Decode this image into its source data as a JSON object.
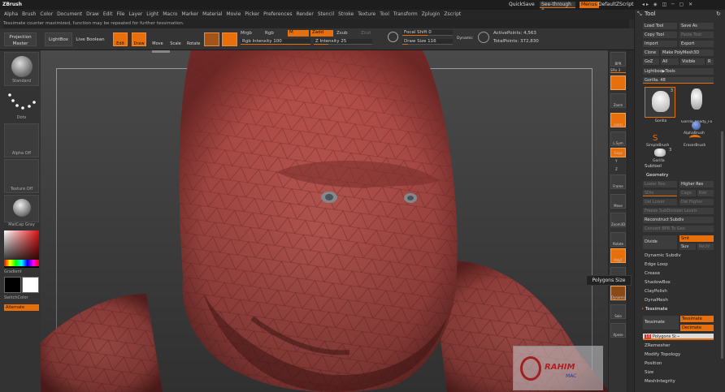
{
  "app": {
    "name": "ZBrush"
  },
  "titlebar": {
    "quicksave": "QuickSave",
    "seethrough": "See-through  0",
    "menus": "Menus",
    "defaultzscript": "DefaultZScript"
  },
  "menubar": [
    "Alpha",
    "Brush",
    "Color",
    "Document",
    "Draw",
    "Edit",
    "File",
    "Layer",
    "Light",
    "Macro",
    "Marker",
    "Material",
    "Movie",
    "Picker",
    "Preferences",
    "Render",
    "Stencil",
    "Stroke",
    "Texture",
    "Tool",
    "Transform",
    "Zplugin",
    "Zscript"
  ],
  "notice": "Tessimate counter maximized, function may be repeated for further tessimation.",
  "toolbar": {
    "projection_master": "Projection Master",
    "lightbox": "LightBox",
    "live_boolean": "Live Boolean",
    "edit": "Edit",
    "draw": "Draw",
    "move": "Move",
    "scale": "Scale",
    "rotate": "Rotate",
    "mrgb": "Mrgb",
    "rgb": "Rgb",
    "m": "M",
    "zadd": "Zadd",
    "zsub": "Zsub",
    "zcut": "Zcut",
    "rgb_intensity_label": "Rgb Intensity",
    "rgb_intensity_value": "100",
    "rgb_intensity_level": 1.0,
    "z_intensity_label": "Z Intensity",
    "z_intensity_value": "25",
    "z_intensity_level": 0.25,
    "focal_shift_label": "Focal Shift",
    "focal_shift_value": "0",
    "focal_shift_level": 0.5,
    "draw_size_label": "Draw Size",
    "draw_size_value": "116",
    "draw_size_level": 0.12,
    "dynamic": "Dynamic",
    "active_points_label": "ActivePoints:",
    "active_points_value": "4,563",
    "total_points_label": "TotalPoints:",
    "total_points_value": "372,830"
  },
  "leftshelf": {
    "brush": "Standard",
    "stroke": "Dots",
    "alpha": "Alpha Off",
    "texture": "Texture Off",
    "material": "MatCap Gray",
    "gradient": "Gradient",
    "switchcolor": "SwitchColor",
    "alternate": "Alternate"
  },
  "rightshelf": {
    "bpr": "BPR",
    "spix": "SPix 3",
    "zoom": "Zoom",
    "actual": "Actual",
    "aahalf": "AAHalf",
    "local": "Local",
    "lsym": "L.Sym",
    "gxyz": "Gxyz",
    "y": "Y",
    "z": "Z",
    "frame": "Frame",
    "move": "Move",
    "zoom3d": "Zoom3D",
    "rotate": "Rotate",
    "polyf": "PolyF",
    "transp": "Transp",
    "dynamic": "Dynamic",
    "solo": "Solo",
    "xpose": "Xpose"
  },
  "tooltip": "Polygons Size",
  "panel": {
    "title": "Tool",
    "load_tool": "Load Tool",
    "save_as": "Save As",
    "copy_tool": "Copy Tool",
    "paste_tool": "Paste Tool",
    "import": "Import",
    "export": "Export",
    "clone": "Clone",
    "make_polymesh": "Make PolyMesh3D",
    "goz": "GoZ",
    "all": "All",
    "visible": "Visible",
    "r": "R",
    "lightbox_tools": "Lightbox▶Tools",
    "gorilla_label": "Gorilla. 48",
    "tools": [
      {
        "name": "Gorilla",
        "count": "3"
      },
      {
        "name": "Gorilla_Ready_Fo",
        "count": ""
      },
      {
        "name": "",
        "count": ""
      },
      {
        "name": "AlphaBrush",
        "count": ""
      },
      {
        "name": "SimpleBrush",
        "count": ""
      },
      {
        "name": "EraserBrush",
        "count": ""
      },
      {
        "name": "Gorilla",
        "count": "3"
      }
    ],
    "subtool": "Subtool",
    "geometry": "Geometry",
    "lower_res": "Lower Res",
    "higher_res": "Higher Res",
    "sdiv": "SDiv",
    "cage": "Cage",
    "rstr": "Rstr",
    "del_lower": "Del Lower",
    "del_higher": "Del Higher",
    "freeze_subdiv": "Freeze SubDivision Levels",
    "reconstruct_subdiv": "Reconstruct Subdiv",
    "convert_bpr": "Convert BPR To Geo",
    "divide": "Divide",
    "smt": "Smt",
    "suv": "Suv",
    "reuv": "ReUV",
    "dynamic_subdiv": "Dynamic Subdiv",
    "edge_loop": "Edge Loop",
    "crease": "Crease",
    "shadowbox": "ShadowBox",
    "claypolish": "ClayPolish",
    "dynamesh": "DynaMesh",
    "tessimate_section": "Tessimate",
    "tessimate_btn": "Tessimate",
    "tessimate_label": "Tessimate",
    "decimate_btn": "Decimate",
    "polygons_size_value": "10",
    "polygons_size_label": "Polygons Size",
    "zremesher": "ZRemesher",
    "modify_topology": "Modify Topology",
    "position": "Position",
    "size": "Size",
    "meshintegrity": "MeshIntegrity"
  },
  "watermark": {
    "line1": "RAHIM",
    "line2": "MAC"
  },
  "colors": {
    "accent": "#e8700c",
    "mesh": "#c85a55",
    "wire": "#7a2a28",
    "panel": "#2f2f2f",
    "canvas": "#4a4a4a"
  }
}
